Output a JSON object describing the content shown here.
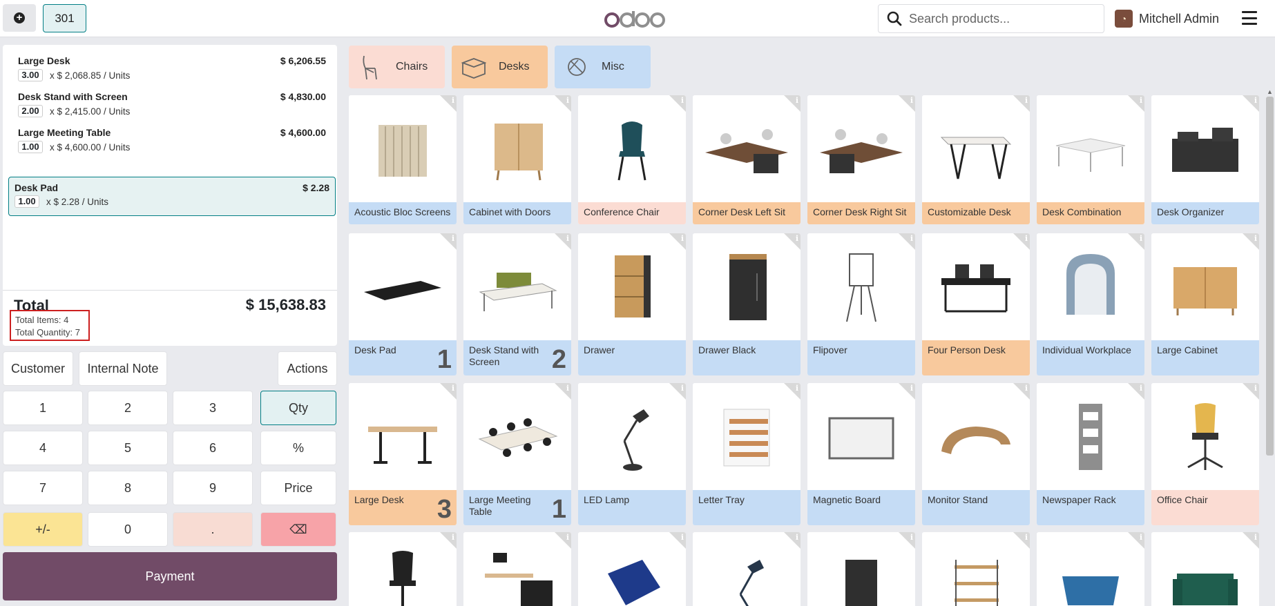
{
  "header": {
    "order_number": "301",
    "logo_text": "odoo",
    "search_placeholder": "Search products...",
    "user_name": "Mitchell Admin"
  },
  "order": {
    "lines": [
      {
        "name": "Large Desk",
        "price": "$ 6,206.55",
        "qty": "3.00",
        "unit": "x $ 2,068.85 / Units"
      },
      {
        "name": "Desk Stand with Screen",
        "price": "$ 4,830.00",
        "qty": "2.00",
        "unit": "x $ 2,415.00 / Units"
      },
      {
        "name": "Large Meeting Table",
        "price": "$ 4,600.00",
        "qty": "1.00",
        "unit": "x $ 4,600.00 / Units"
      },
      {
        "name": "Desk Pad",
        "price": "$ 2.28",
        "qty": "1.00",
        "unit": "x $ 2.28 / Units"
      }
    ],
    "total_label": "Total",
    "total_value": "$ 15,638.83",
    "total_items": "Total Items: 4",
    "total_quantity": "Total Quantity: 7"
  },
  "controls": {
    "customer": "Customer",
    "internal_note": "Internal Note",
    "actions": "Actions",
    "payment": "Payment"
  },
  "numpad": {
    "keys": [
      "1",
      "2",
      "3",
      "4",
      "5",
      "6",
      "7",
      "8",
      "9",
      "+/-",
      "0",
      "."
    ],
    "qty": "Qty",
    "disc": "%",
    "price": "Price",
    "backspace": "⌫"
  },
  "categories": [
    {
      "name": "Chairs",
      "color": "#fbdcd3"
    },
    {
      "name": "Desks",
      "color": "#f8c99d"
    },
    {
      "name": "Misc",
      "color": "#c5dcf5"
    }
  ],
  "products": [
    {
      "name": "Acoustic Bloc Screens",
      "count": ""
    },
    {
      "name": "Cabinet with Doors",
      "count": ""
    },
    {
      "name": "Conference Chair",
      "count": ""
    },
    {
      "name": "Corner Desk Left Sit",
      "count": ""
    },
    {
      "name": "Corner Desk Right Sit",
      "count": ""
    },
    {
      "name": "Customizable Desk",
      "count": ""
    },
    {
      "name": "Desk Combination",
      "count": ""
    },
    {
      "name": "Desk Organizer",
      "count": ""
    },
    {
      "name": "Desk Pad",
      "count": "1"
    },
    {
      "name": "Desk Stand with Screen",
      "count": "2"
    },
    {
      "name": "Drawer",
      "count": ""
    },
    {
      "name": "Drawer Black",
      "count": ""
    },
    {
      "name": "Flipover",
      "count": ""
    },
    {
      "name": "Four Person Desk",
      "count": ""
    },
    {
      "name": "Individual Workplace",
      "count": ""
    },
    {
      "name": "Large Cabinet",
      "count": ""
    },
    {
      "name": "Large Desk",
      "count": "3"
    },
    {
      "name": "Large Meeting Table",
      "count": "1"
    },
    {
      "name": "LED Lamp",
      "count": ""
    },
    {
      "name": "Letter Tray",
      "count": ""
    },
    {
      "name": "Magnetic Board",
      "count": ""
    },
    {
      "name": "Monitor Stand",
      "count": ""
    },
    {
      "name": "Newspaper Rack",
      "count": ""
    },
    {
      "name": "Office Chair",
      "count": ""
    }
  ],
  "colors": {
    "brand": "#714b67",
    "accent": "#017e84",
    "misc": "#c5dcf5",
    "desks": "#f8c99d",
    "chairs": "#fbdcd3"
  }
}
